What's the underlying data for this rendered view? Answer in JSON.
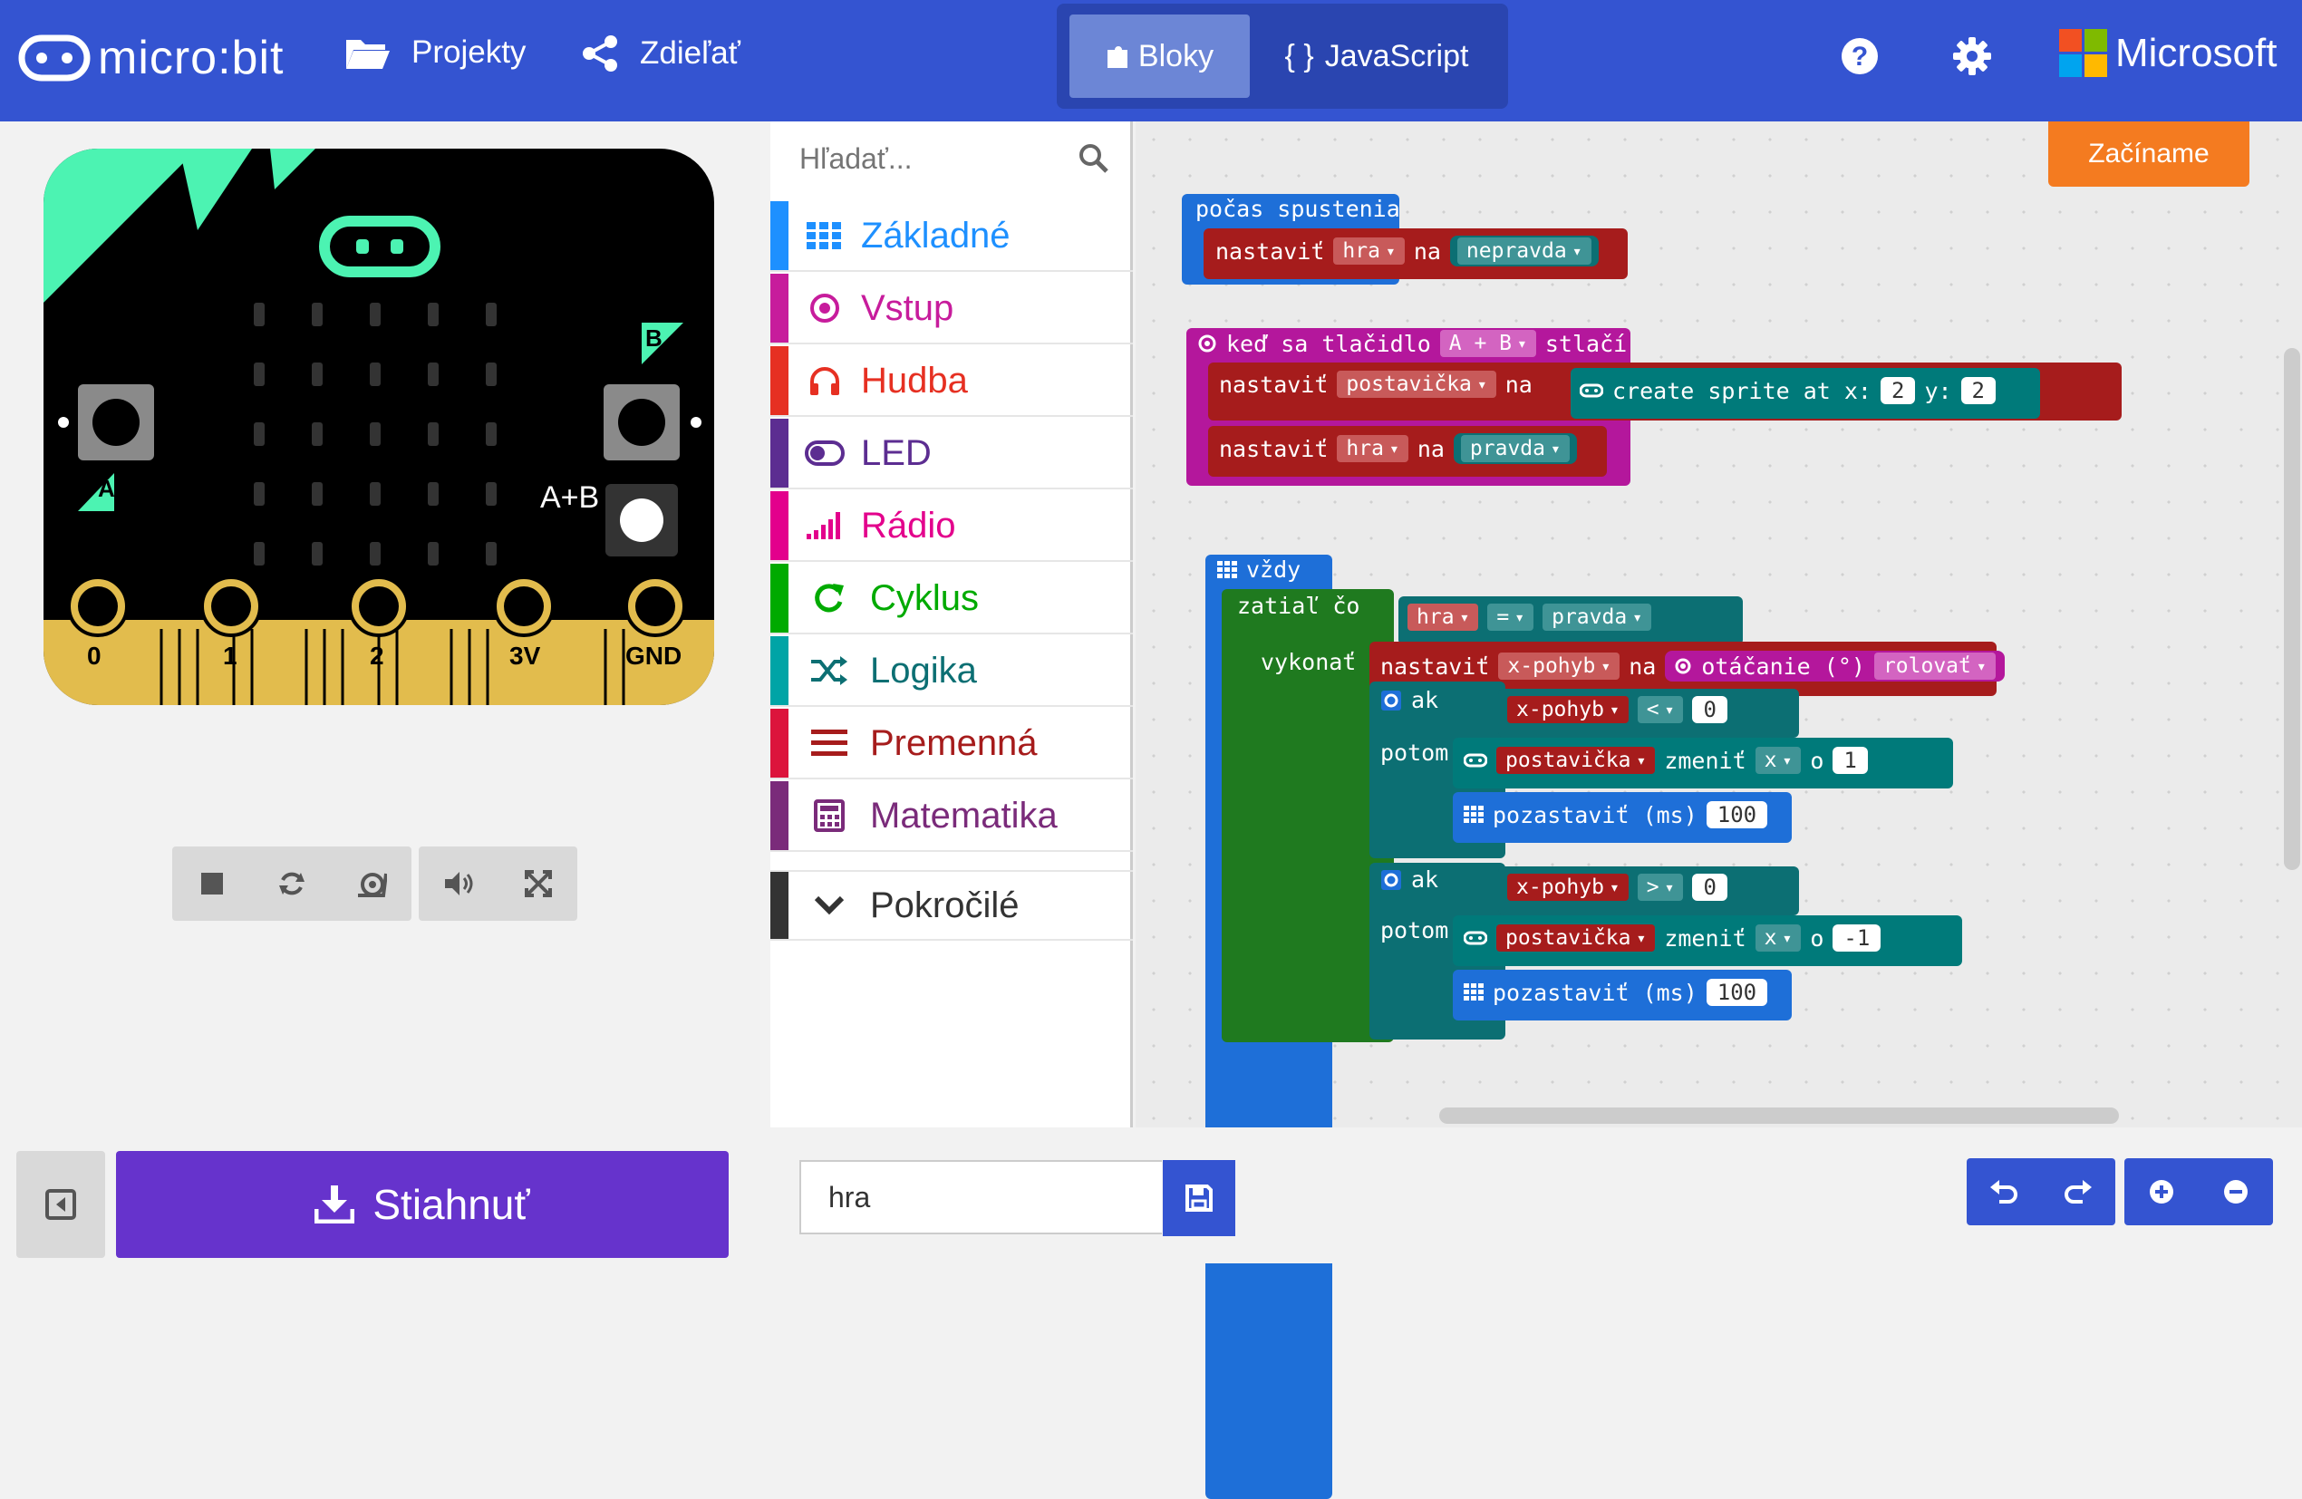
{
  "header": {
    "logo_text": "micro:bit",
    "nav": [
      {
        "label": "Projekty",
        "icon": "folder-icon"
      },
      {
        "label": "Zdieľať",
        "icon": "share-icon"
      }
    ],
    "tabs": {
      "blocks": "Bloky",
      "javascript": "JavaScript",
      "js_icon": "{ }"
    },
    "brand": "Microsoft"
  },
  "simulator": {
    "pins": [
      "0",
      "1",
      "2",
      "3V",
      "GND"
    ],
    "button_labels": {
      "a": "A",
      "b": "B",
      "ab": "A+B"
    }
  },
  "toolbox": {
    "search_placeholder": "Hľadať...",
    "categories": [
      {
        "label": "Základné",
        "color": "#1e90ff",
        "icon": "grid-icon"
      },
      {
        "label": "Vstup",
        "color": "#c71c9c",
        "icon": "target-icon"
      },
      {
        "label": "Hudba",
        "color": "#e63022",
        "icon": "headphones-icon"
      },
      {
        "label": "LED",
        "color": "#5c2d91",
        "icon": "toggle-icon"
      },
      {
        "label": "Rádio",
        "color": "#e3008c",
        "icon": "signal-icon"
      },
      {
        "label": "Cyklus",
        "color": "#00aa00",
        "icon": "refresh-icon"
      },
      {
        "label": "Logika",
        "color": "#00a4a6",
        "icon": "shuffle-icon"
      },
      {
        "label": "Premenná",
        "color": "#dc143c",
        "icon": "list-icon"
      },
      {
        "label": "Matematika",
        "color": "#9400d3",
        "icon": "calculator-icon"
      },
      {
        "label": "Pokročilé",
        "color": "#333333",
        "icon": "chevron-down-icon"
      }
    ]
  },
  "workspace": {
    "getting_started": "Začíname",
    "on_start": {
      "label": "počas spustenia",
      "set_kw": "nastaviť",
      "var": "hra",
      "to_kw": "na",
      "value": "nepravda"
    },
    "on_button": {
      "when_kw": "keď sa tlačidlo",
      "button": "A + B",
      "pressed_kw": "stlačí",
      "set1_kw": "nastaviť",
      "set1_var": "postavička",
      "set1_to": "na",
      "create_sprite": "create sprite at x:",
      "x_val": "2",
      "y_kw": "y:",
      "y_val": "2",
      "set2_kw": "nastaviť",
      "set2_var": "hra",
      "set2_to": "na",
      "set2_val": "pravda"
    },
    "forever": {
      "label": "vždy",
      "while_kw": "zatiaľ čo",
      "while_var": "hra",
      "op": "=",
      "while_val": "pravda",
      "do_kw": "vykonať",
      "set_kw": "nastaviť",
      "set_var": "x-pohyb",
      "set_to": "na",
      "rotation": "otáčanie (°)",
      "rotation_dir": "rolovať",
      "if1": {
        "if_kw": "ak",
        "var": "x-pohyb",
        "op": "<",
        "val": "0",
        "then_kw": "potom",
        "sprite": "postavička",
        "change_kw": "zmeniť",
        "axis": "x",
        "by_kw": "o",
        "by_val": "1",
        "pause_kw": "pozastaviť (ms)",
        "pause_val": "100"
      },
      "if2": {
        "if_kw": "ak",
        "var": "x-pohyb",
        "op": ">",
        "val": "0",
        "then_kw": "potom",
        "sprite": "postavička",
        "change_kw": "zmeniť",
        "axis": "x",
        "by_kw": "o",
        "by_val": "-1",
        "pause_kw": "pozastaviť (ms)",
        "pause_val": "100"
      }
    }
  },
  "bottom": {
    "download_label": "Stiahnuť",
    "project_name": "hra"
  },
  "colors": {
    "header": "#3454d1",
    "download": "#6633cc",
    "getting_started": "#f47b20",
    "variables": "#a61c1c",
    "loops": "#1f7a1f",
    "logic": "#0c6f73",
    "basic": "#1e6fd8",
    "input": "#b4179c",
    "game": "#007a7a"
  }
}
